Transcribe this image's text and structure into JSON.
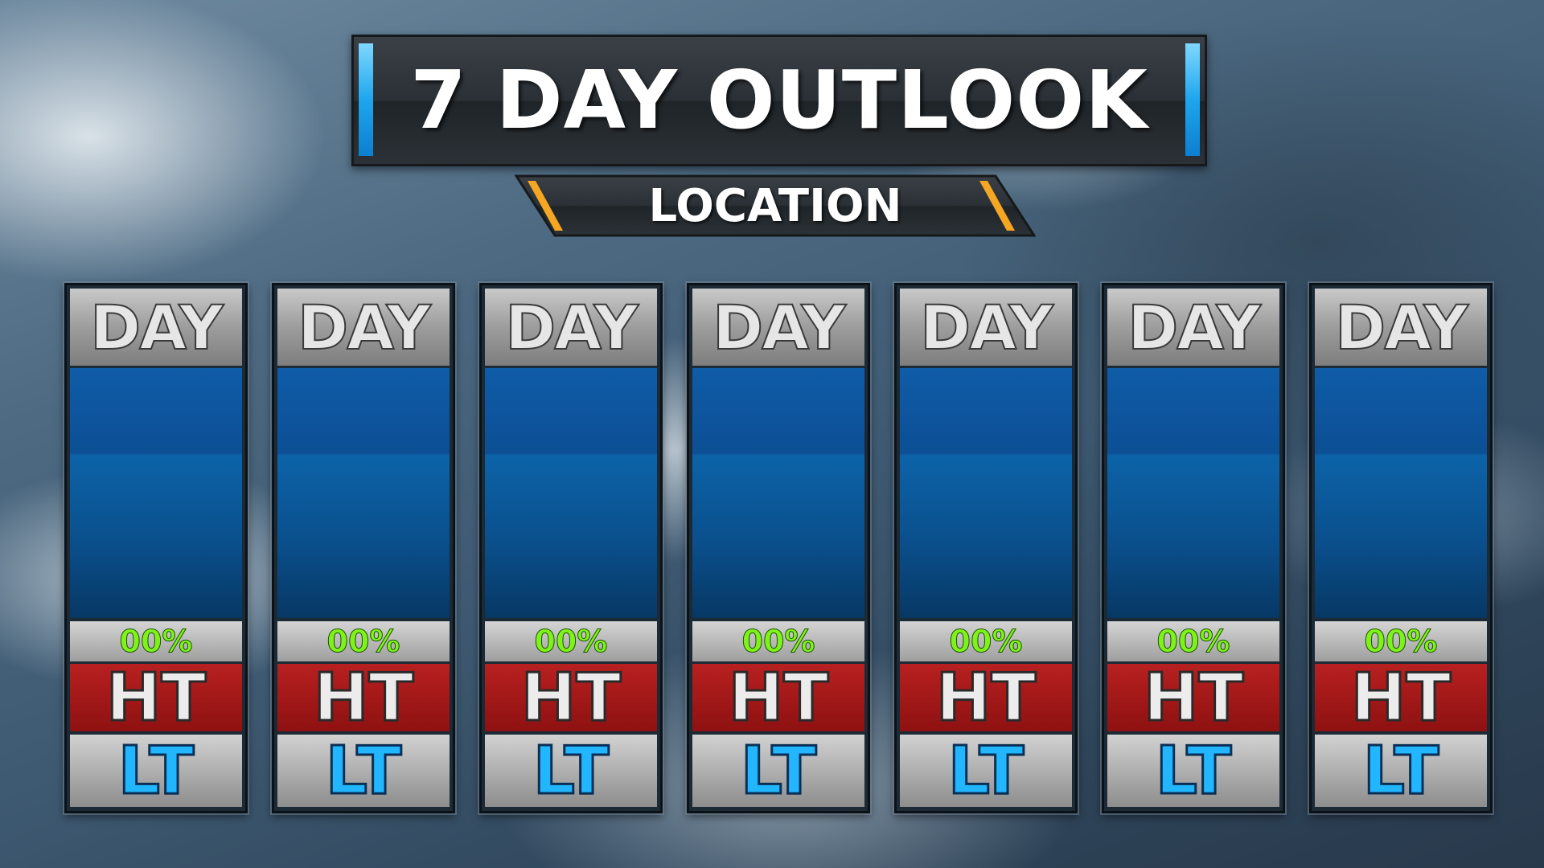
{
  "title": "7 DAY OUTLOOK",
  "location": "LOCATION",
  "colors": {
    "title_accent": "#1ea6ee",
    "location_accent": "#f5a623",
    "sky_panel": "#0c4f95",
    "precip_text": "#7ef21a",
    "high_band": "#a51a1a",
    "low_text": "#22b6ff"
  },
  "days": [
    {
      "label": "DAY",
      "precip": "00%",
      "high": "HT",
      "low": "LT"
    },
    {
      "label": "DAY",
      "precip": "00%",
      "high": "HT",
      "low": "LT"
    },
    {
      "label": "DAY",
      "precip": "00%",
      "high": "HT",
      "low": "LT"
    },
    {
      "label": "DAY",
      "precip": "00%",
      "high": "HT",
      "low": "LT"
    },
    {
      "label": "DAY",
      "precip": "00%",
      "high": "HT",
      "low": "LT"
    },
    {
      "label": "DAY",
      "precip": "00%",
      "high": "HT",
      "low": "LT"
    },
    {
      "label": "DAY",
      "precip": "00%",
      "high": "HT",
      "low": "LT"
    }
  ]
}
